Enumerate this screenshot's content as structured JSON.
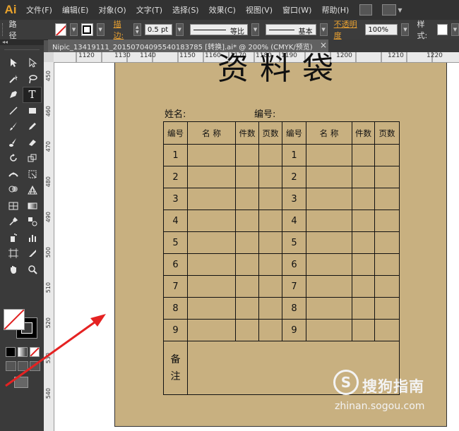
{
  "app": {
    "logo": "Ai",
    "menu": [
      "文件(F)",
      "编辑(E)",
      "对象(O)",
      "文字(T)",
      "选择(S)",
      "效果(C)",
      "视图(V)",
      "窗口(W)",
      "帮助(H)"
    ]
  },
  "control": {
    "label": "路径",
    "stroke_label": "描边:",
    "stroke_value": "0.5 pt",
    "profile": "等比",
    "brush": "基本",
    "opacity_label": "不透明度",
    "opacity_value": "100%",
    "style_label": "样式:"
  },
  "document": {
    "tab_title": "Nipic_13419111_20150704095540183785 [转换].ai* @ 200% (CMYK/预览)",
    "close_glyph": "×"
  },
  "ruler": {
    "top_ticks": [
      "1120",
      "1130",
      "1140",
      "1150",
      "1160",
      "1170",
      "1180",
      "1190",
      "1200",
      "1210",
      "1220"
    ],
    "left_ticks": [
      "450",
      "460",
      "470",
      "480",
      "490",
      "500",
      "510",
      "520",
      "530",
      "540"
    ]
  },
  "artwork": {
    "title": "资料袋",
    "name_label": "姓名:",
    "number_label": "编号:",
    "headers": [
      "编号",
      "名  称",
      "件数",
      "页数",
      "编号",
      "名  称",
      "件数",
      "页数"
    ],
    "rows": [
      "1",
      "2",
      "3",
      "4",
      "5",
      "6",
      "7",
      "8",
      "9"
    ],
    "note_chars": [
      "备",
      "注"
    ]
  },
  "watermark": {
    "logo": "S",
    "text": "搜狗指南",
    "url": "zhinan.sogou.com"
  },
  "colors": {
    "artboard": "#c8b080",
    "accent_orange": "#e8a030",
    "arrow_red": "#e52222"
  },
  "icons": {
    "tools": [
      "selection-icon",
      "direct-selection-icon",
      "magic-wand-icon",
      "lasso-icon",
      "pen-icon",
      "type-icon",
      "line-icon",
      "rectangle-icon",
      "paintbrush-icon",
      "pencil-icon",
      "blob-brush-icon",
      "eraser-icon",
      "rotate-icon",
      "scale-icon",
      "width-icon",
      "free-transform-icon",
      "shape-builder-icon",
      "perspective-grid-icon",
      "mesh-icon",
      "gradient-icon",
      "eyedropper-icon",
      "blend-icon",
      "symbol-sprayer-icon",
      "column-graph-icon",
      "artboard-icon",
      "slice-icon",
      "hand-icon",
      "zoom-icon"
    ]
  }
}
